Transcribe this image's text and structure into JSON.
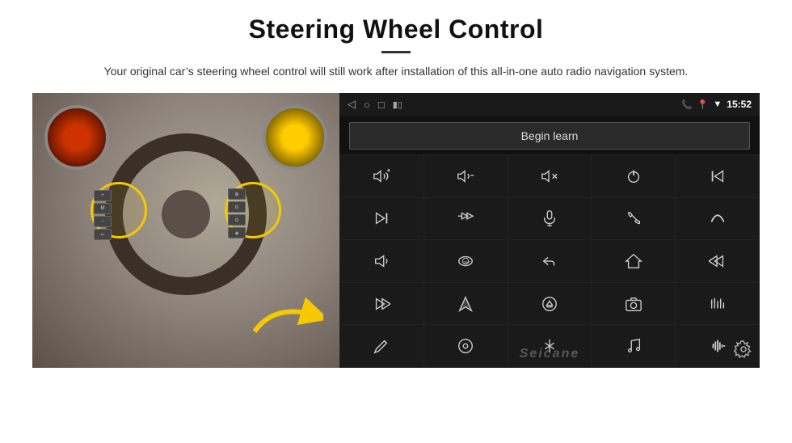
{
  "header": {
    "title": "Steering Wheel Control",
    "subtitle": "Your original car’s steering wheel control will still work after installation of this all-in-one auto radio navigation system."
  },
  "status_bar": {
    "time": "15:52",
    "phone_icon": "☎",
    "location_icon": "▶",
    "wifi_icon": "▼",
    "battery_icon": "■"
  },
  "begin_learn_button": {
    "label": "Begin learn"
  },
  "icon_grid": [
    {
      "icon": "vol+",
      "unicode": "🔊+",
      "name": "volume-up"
    },
    {
      "icon": "vol-",
      "unicode": "🔊−",
      "name": "volume-down"
    },
    {
      "icon": "mute",
      "unicode": "🔇",
      "name": "mute"
    },
    {
      "icon": "power",
      "unicode": "⏻",
      "name": "power"
    },
    {
      "icon": "prev-track",
      "unicode": "⏮",
      "name": "prev-track-end"
    },
    {
      "icon": "skip-fwd",
      "unicode": "⏭",
      "name": "skip-forward"
    },
    {
      "icon": "fast-fwd-skip",
      "unicode": "⏭",
      "name": "fast-forward-skip"
    },
    {
      "icon": "mic",
      "unicode": "🎤",
      "name": "microphone"
    },
    {
      "icon": "phone",
      "unicode": "📞",
      "name": "phone"
    },
    {
      "icon": "hang-up",
      "unicode": "📵",
      "name": "hang-up"
    },
    {
      "icon": "speaker",
      "unicode": "📢",
      "name": "speaker"
    },
    {
      "icon": "360",
      "unicode": "360°",
      "name": "360-view"
    },
    {
      "icon": "back",
      "unicode": "↩",
      "name": "back"
    },
    {
      "icon": "home",
      "unicode": "⌂",
      "name": "home"
    },
    {
      "icon": "skip-back",
      "unicode": "⏮",
      "name": "skip-back"
    },
    {
      "icon": "next",
      "unicode": "⏭",
      "name": "next"
    },
    {
      "icon": "navigate",
      "unicode": "➤",
      "name": "navigate"
    },
    {
      "icon": "eject",
      "unicode": "⏏",
      "name": "eject"
    },
    {
      "icon": "camera",
      "unicode": "📷",
      "name": "camera"
    },
    {
      "icon": "equalizer",
      "unicode": "⊞",
      "name": "equalizer"
    },
    {
      "icon": "pen",
      "unicode": "✏",
      "name": "pen"
    },
    {
      "icon": "settings-circle",
      "unicode": "⚙",
      "name": "settings-circle"
    },
    {
      "icon": "bluetooth",
      "unicode": "✳",
      "name": "bluetooth"
    },
    {
      "icon": "music",
      "unicode": "♫",
      "name": "music"
    },
    {
      "icon": "sound-bars",
      "unicode": "▐",
      "name": "sound-bars"
    }
  ],
  "watermark": {
    "text": "Seicane"
  }
}
